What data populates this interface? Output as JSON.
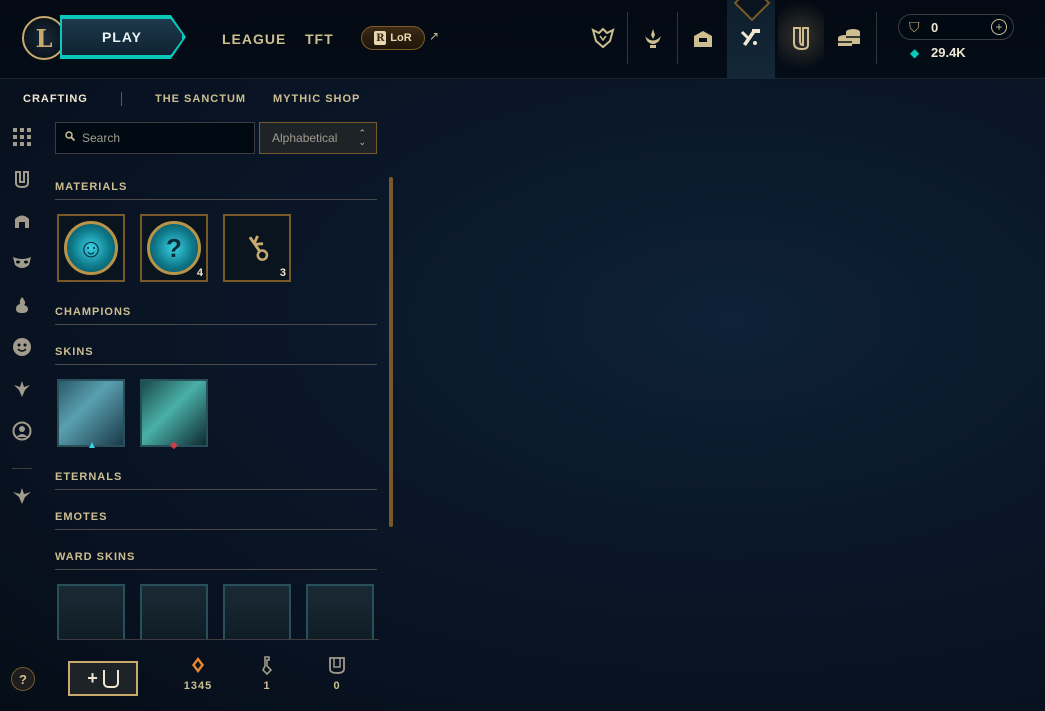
{
  "header": {
    "logo_letter": "L",
    "play_label": "PLAY",
    "nav": [
      "LEAGUE",
      "TFT"
    ],
    "lor_label": "LoR",
    "lor_badge": "R",
    "external_arrow": "↗"
  },
  "top_icons": [
    "worlds-icon",
    "honor-icon",
    "store-bag-icon",
    "crafting-hammer-icon",
    "collection-icon",
    "loot-coins-icon"
  ],
  "currency": {
    "rp_value": "0",
    "be_value": "29.4K",
    "add_label": "+"
  },
  "subtabs": [
    "CRAFTING",
    "THE SANCTUM",
    "MYTHIC SHOP"
  ],
  "filter": {
    "search_placeholder": "Search",
    "sort_value": "Alphabetical"
  },
  "sections": {
    "materials": "MATERIALS",
    "champions": "CHAMPIONS",
    "skins": "SKINS",
    "eternals": "ETERNALS",
    "emotes": "EMOTES",
    "ward_skins": "WARD SKINS"
  },
  "materials": [
    {
      "name": "emote-orb",
      "count": ""
    },
    {
      "name": "mystery-orb",
      "count": "4"
    },
    {
      "name": "hextech-key",
      "count": "3"
    }
  ],
  "footer": {
    "add_label": "+",
    "orange_essence": "1345",
    "key_fragments": "1",
    "chests": "0"
  },
  "help_label": "?",
  "colors": {
    "gold": "#c8aa6e",
    "teal": "#0ac8b9",
    "background": "#0a1628"
  }
}
